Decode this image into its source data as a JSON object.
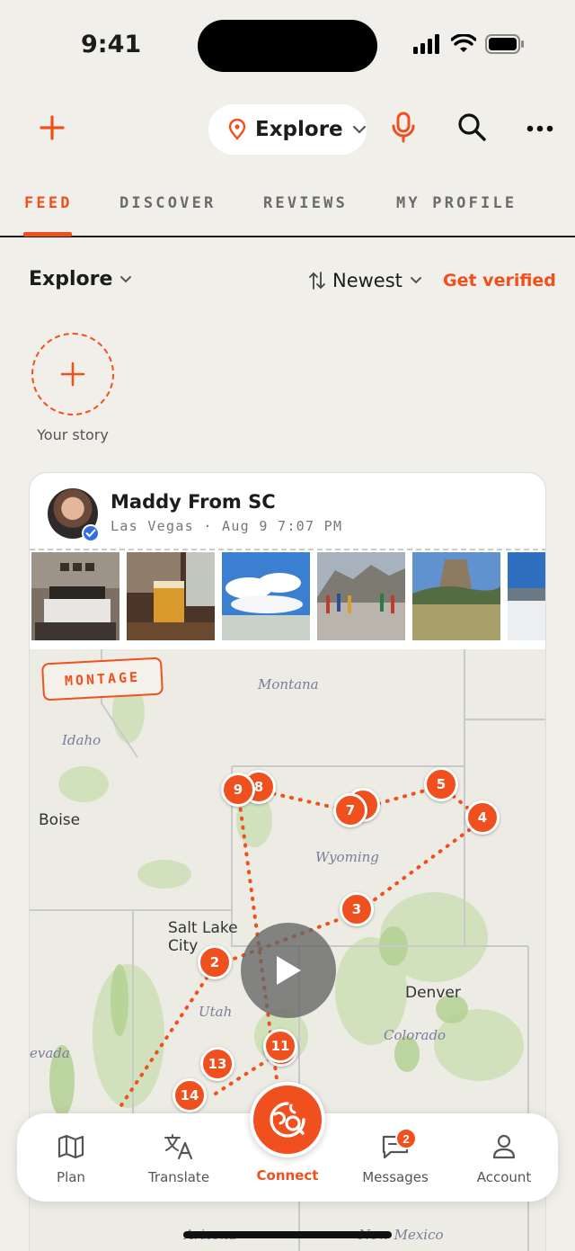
{
  "status_bar": {
    "time": "9:41"
  },
  "top_bar": {
    "location_label": "Explore"
  },
  "tabs": [
    {
      "label": "FEED",
      "active": true
    },
    {
      "label": "DISCOVER",
      "active": false
    },
    {
      "label": "REVIEWS",
      "active": false
    },
    {
      "label": "MY PROFILE",
      "active": false
    }
  ],
  "filters": {
    "scope": "Explore",
    "sort": "Newest",
    "verify_link": "Get verified"
  },
  "story": {
    "label": "Your story"
  },
  "post": {
    "author": "Maddy From SC",
    "location": "Las Vegas",
    "separator": "·",
    "date": "Aug 9 7:07 PM",
    "photos": [
      "bedroom",
      "beer-glass",
      "clouds-field",
      "monument-flags",
      "devils-tower",
      "snow-lake"
    ],
    "badge": "MONTAGE",
    "map": {
      "region_labels": [
        "Montana",
        "Idaho",
        "Wyoming",
        "Utah",
        "Colorado",
        "evada",
        "Arizona",
        "New Mexico"
      ],
      "cities": [
        "Boise",
        "Salt Lake City",
        "Denver"
      ],
      "pins": [
        "9",
        "8",
        "7",
        "5",
        "4",
        "3",
        "2",
        "11",
        "13",
        "14"
      ]
    }
  },
  "bottom_nav": {
    "items": [
      {
        "label": "Plan",
        "icon": "map-icon"
      },
      {
        "label": "Translate",
        "icon": "translate-icon"
      },
      {
        "label": "Connect",
        "icon": "connect-icon",
        "active": true
      },
      {
        "label": "Messages",
        "icon": "messages-icon",
        "badge": "2"
      },
      {
        "label": "Account",
        "icon": "account-icon"
      }
    ]
  },
  "colors": {
    "accent": "#f0501e",
    "background": "#f1efea",
    "verified": "#2f6ee8"
  }
}
